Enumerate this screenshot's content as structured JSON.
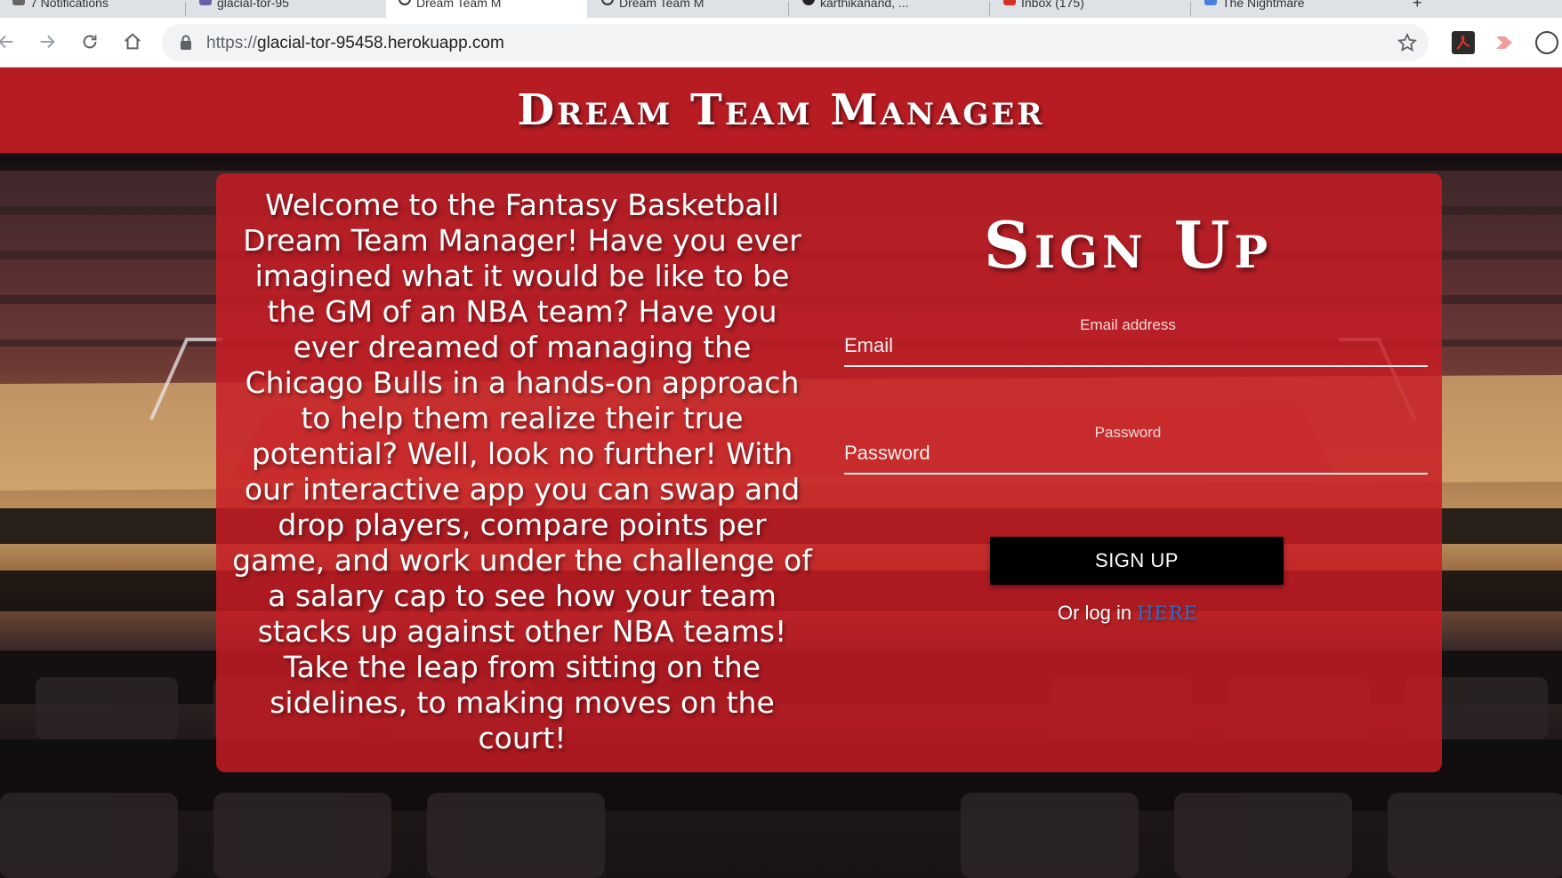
{
  "browser": {
    "tabs": [
      {
        "label": "7 Notifications"
      },
      {
        "label": "glacial-tor-95"
      },
      {
        "label": "Dream Team M"
      },
      {
        "label": "Dream Team M"
      },
      {
        "label": "karthikanand, ..."
      },
      {
        "label": "Inbox (175)"
      },
      {
        "label": "The Nightmare"
      }
    ],
    "url_prefix": "https://",
    "url_host": "glacial-tor-95458.herokuapp.com"
  },
  "header": {
    "title": "Dream Team Manager",
    "color": "#b81c23"
  },
  "welcome": {
    "text": "Welcome to the Fantasy Basketball Dream Team Manager! Have you ever imagined what it would be like to be the GM of an NBA team? Have you ever dreamed of managing the Chicago Bulls in a hands-on approach to help them realize their true potential? Well, look no further! With our interactive app you can swap and drop players, compare points per game, and work under the challenge of a salary cap to see how your team stacks up against other NBA teams! Take the leap from sitting on the sidelines, to making moves on the court!"
  },
  "signup": {
    "title": "Sign Up",
    "email_label": "Email address",
    "email_placeholder": "Email",
    "password_label": "Password",
    "password_placeholder": "Password",
    "button_label": "SIGN UP",
    "login_prefix": "Or log in",
    "login_link": "HERE"
  }
}
